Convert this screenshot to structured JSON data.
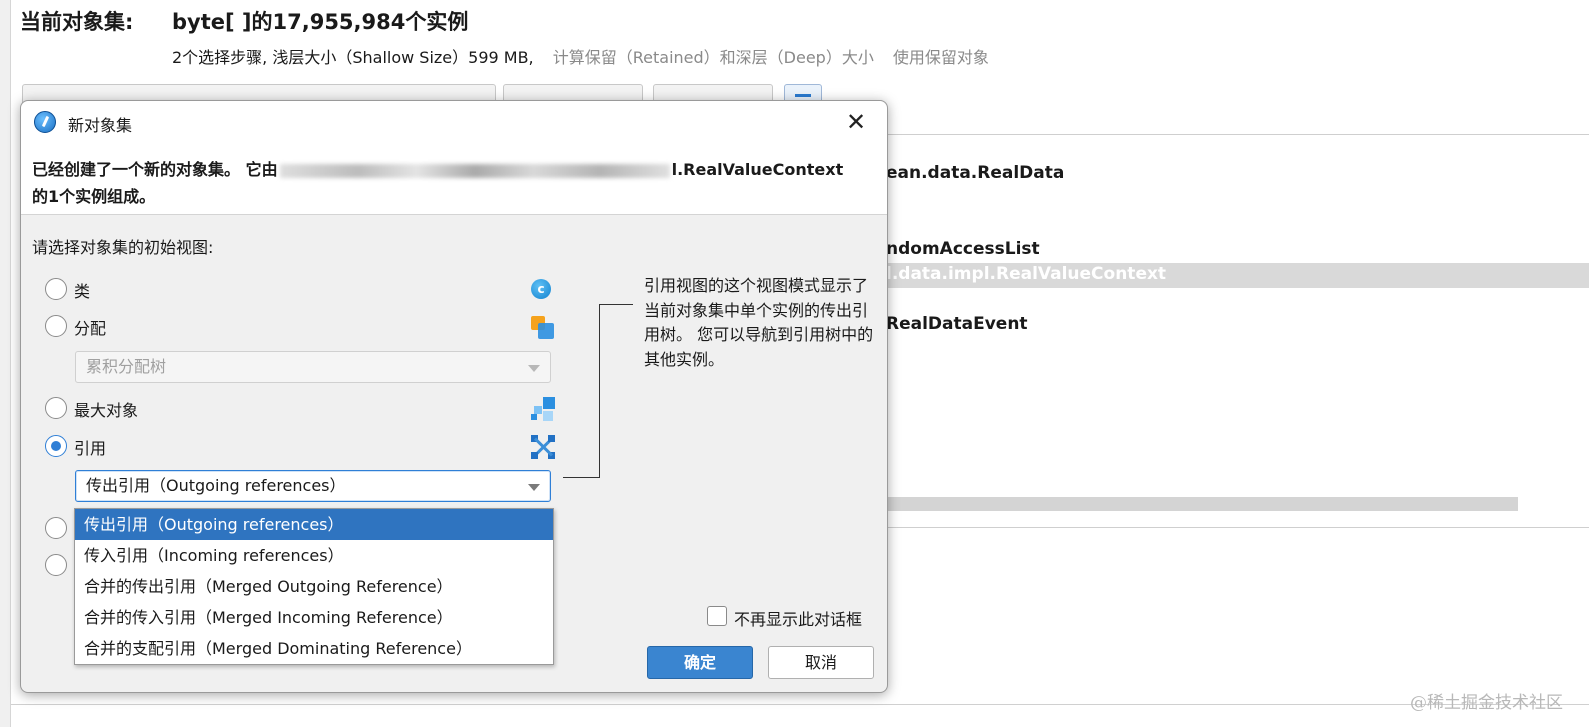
{
  "header": {
    "label": "当前对象集:",
    "title": "byte[ ]的17,955,984个实例",
    "subline_main": "2个选择步骤, 浅层大小（Shallow Size）599 MB,",
    "subline_retained": "计算保留（Retained）和深层（Deep）大小",
    "subline_use_retained": "使用保留对象"
  },
  "right_panel": {
    "rows": [
      "ean.data.RealData",
      "ndomAccessList",
      "l.data.impl.RealValueContext",
      "RealDataEvent"
    ]
  },
  "dialog": {
    "title": "新对象集",
    "message_prefix": "已经创建了一个新的对象集。 它由",
    "message_suffix": "l.RealValueContext",
    "message_line2": "的1个实例组成。",
    "prompt": "请选择对象集的初始视图:",
    "options": [
      {
        "label": "类",
        "checked": false,
        "icon": "class-icon"
      },
      {
        "label": "分配",
        "checked": false,
        "icon": "allocation-icon"
      },
      {
        "label": "最大对象",
        "checked": false,
        "icon": "biggest-objects-icon"
      },
      {
        "label": "引用",
        "checked": true,
        "icon": "references-icon"
      }
    ],
    "allocation_select": "累积分配树",
    "references_select": "传出引用（Outgoing references）",
    "dropdown_items": [
      "传出引用（Outgoing references）",
      "传入引用（Incoming references）",
      "合并的传出引用（Merged Outgoing Reference）",
      "合并的传入引用（Merged Incoming Reference）",
      "合并的支配引用（Merged Dominating Reference）"
    ],
    "dropdown_selected_index": 0,
    "description": "引用视图的这个视图模式显示了当前对象集中单个实例的传出引用树。 您可以导航到引用树中的其他实例。",
    "dont_show_again": "不再显示此对话框",
    "dont_show_again_checked": false,
    "ok": "确定",
    "cancel": "取消"
  },
  "watermark": "@稀土掘金技术社区",
  "colors": {
    "accent": "#2f7fd6",
    "ok_button": "#3a85d0",
    "selected_item": "#2f74c0"
  }
}
